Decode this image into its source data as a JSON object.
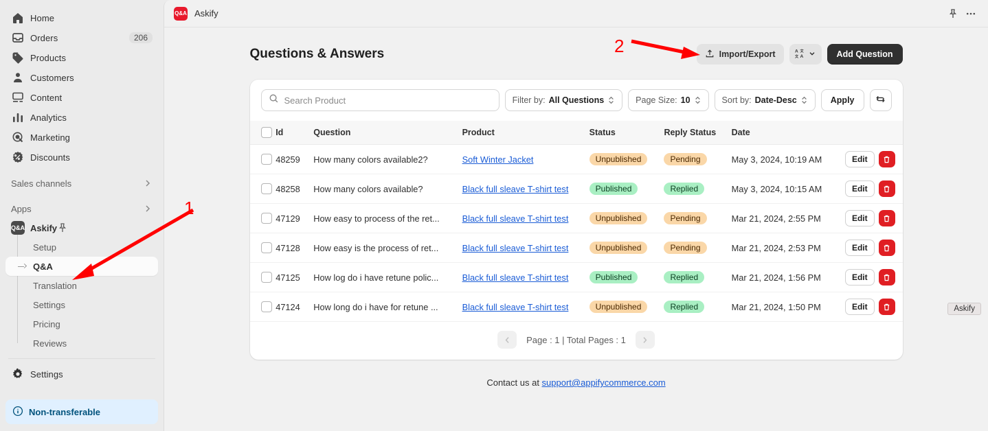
{
  "sidebar": {
    "items": [
      {
        "label": "Home",
        "icon": "home-icon",
        "badge": ""
      },
      {
        "label": "Orders",
        "icon": "orders-icon",
        "badge": "206"
      },
      {
        "label": "Products",
        "icon": "products-icon",
        "badge": ""
      },
      {
        "label": "Customers",
        "icon": "customers-icon",
        "badge": ""
      },
      {
        "label": "Content",
        "icon": "content-icon",
        "badge": ""
      },
      {
        "label": "Analytics",
        "icon": "analytics-icon",
        "badge": ""
      },
      {
        "label": "Marketing",
        "icon": "marketing-icon",
        "badge": ""
      },
      {
        "label": "Discounts",
        "icon": "discounts-icon",
        "badge": ""
      }
    ],
    "sales_channels_label": "Sales channels",
    "apps_label": "Apps",
    "app": {
      "name": "Askify",
      "logo_text": "Q&A",
      "pin_icon": "pin-icon",
      "sub_items": [
        {
          "label": "Setup",
          "active": false
        },
        {
          "label": "Q&A",
          "active": true
        },
        {
          "label": "Translation",
          "active": false
        },
        {
          "label": "Settings",
          "active": false
        },
        {
          "label": "Pricing",
          "active": false
        },
        {
          "label": "Reviews",
          "active": false
        }
      ]
    },
    "settings_label": "Settings",
    "non_transferable": "Non-transferable"
  },
  "topbar": {
    "app_title": "Askify",
    "logo_text": "Q&A",
    "pin_icon": "pin-icon",
    "more_icon": "more-horizontal-icon"
  },
  "page": {
    "title": "Questions & Answers",
    "import_export_label": "Import/Export",
    "translate_label": "",
    "add_question_label": "Add Question"
  },
  "filters": {
    "search_placeholder": "Search Product",
    "search_value": "",
    "filter_by_label": "Filter by:",
    "filter_by_value": "All Questions",
    "page_size_label": "Page Size:",
    "page_size_value": "10",
    "sort_by_label": "Sort by:",
    "sort_by_value": "Date-Desc",
    "apply_label": "Apply",
    "refresh_icon": "refresh-icon"
  },
  "table": {
    "headers": [
      "Id",
      "Question",
      "Product",
      "Status",
      "Reply Status",
      "Date"
    ],
    "edit_label": "Edit",
    "delete_icon": "trash-icon",
    "rows": [
      {
        "id": "48259",
        "question": "How many colors available2?",
        "product": "Soft Winter Jacket",
        "status": "Unpublished",
        "status_color": "orange",
        "reply_status": "Pending",
        "reply_color": "orange",
        "date": "May 3, 2024, 10:19 AM"
      },
      {
        "id": "48258",
        "question": "How many colors available?",
        "product": "Black full sleave T-shirt test",
        "status": "Published",
        "status_color": "green",
        "reply_status": "Replied",
        "reply_color": "green",
        "date": "May 3, 2024, 10:15 AM"
      },
      {
        "id": "47129",
        "question": "How easy to process of the ret...",
        "product": "Black full sleave T-shirt test",
        "status": "Unpublished",
        "status_color": "orange",
        "reply_status": "Pending",
        "reply_color": "orange",
        "date": "Mar 21, 2024, 2:55 PM"
      },
      {
        "id": "47128",
        "question": "How easy is the process of ret...",
        "product": "Black full sleave T-shirt test",
        "status": "Unpublished",
        "status_color": "orange",
        "reply_status": "Pending",
        "reply_color": "orange",
        "date": "Mar 21, 2024, 2:53 PM"
      },
      {
        "id": "47125",
        "question": "How log do i have retune polic...",
        "product": "Black full sleave T-shirt test",
        "status": "Published",
        "status_color": "green",
        "reply_status": "Replied",
        "reply_color": "green",
        "date": "Mar 21, 2024, 1:56 PM"
      },
      {
        "id": "47124",
        "question": "How long do i have for retune ...",
        "product": "Black full sleave T-shirt test",
        "status": "Unpublished",
        "status_color": "orange",
        "reply_status": "Replied",
        "reply_color": "green",
        "date": "Mar 21, 2024, 1:50 PM"
      }
    ]
  },
  "pagination": {
    "label": "Page : 1 | Total Pages : 1"
  },
  "footer": {
    "text": "Contact us at ",
    "email": "support@appifycommerce.com"
  },
  "tooltip": {
    "label": "Askify"
  },
  "annotations": [
    {
      "number": "1",
      "color": "#ff0000"
    },
    {
      "number": "2",
      "color": "#ff0000"
    }
  ],
  "colors": {
    "accent_red": "#e8192c",
    "link_blue": "#1a5cd6",
    "tag_orange_bg": "#fad7a8",
    "tag_green_bg": "#a9efc3",
    "dark_button": "#303030",
    "annotation_red": "#ff0000"
  }
}
